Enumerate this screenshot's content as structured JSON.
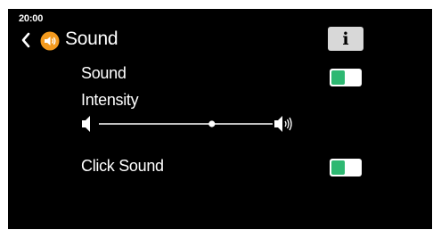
{
  "status": {
    "time": "20:00"
  },
  "header": {
    "back_icon": "chevron-left-icon",
    "title_icon": "speaker-icon",
    "title_icon_color": "#f39a1e",
    "title": "Sound",
    "info_icon": "info-icon",
    "info_label": "i"
  },
  "settings": {
    "sound": {
      "label": "Sound",
      "on": true
    },
    "intensity": {
      "label": "Intensity",
      "value_fraction": 0.65,
      "min_icon": "speaker-low-icon",
      "max_icon": "speaker-high-icon"
    },
    "click_sound": {
      "label": "Click Sound",
      "on": true
    }
  },
  "colors": {
    "background": "#000000",
    "text": "#ffffff",
    "toggle_on": "#2eb872",
    "button": "#d8d8d8"
  }
}
